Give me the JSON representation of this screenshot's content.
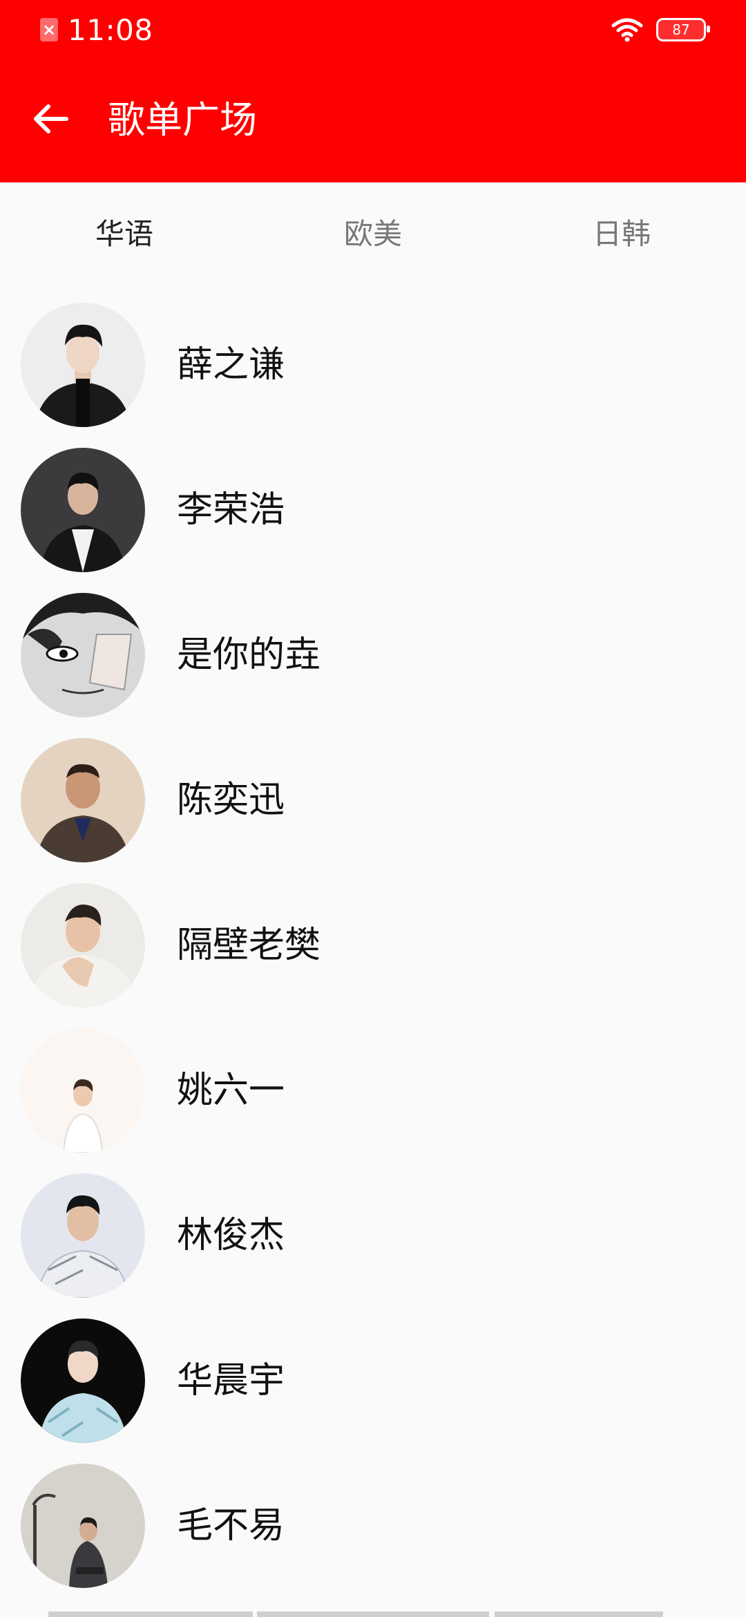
{
  "status_bar": {
    "time": "11:08",
    "battery_level": "87"
  },
  "toolbar": {
    "title": "歌单广场"
  },
  "tabs": [
    {
      "label": "华语",
      "active": true
    },
    {
      "label": "欧美",
      "active": false
    },
    {
      "label": "日韩",
      "active": false
    }
  ],
  "artists": [
    {
      "name": "薛之谦"
    },
    {
      "name": "李荣浩"
    },
    {
      "name": "是你的垚"
    },
    {
      "name": "陈奕迅"
    },
    {
      "name": "隔壁老樊"
    },
    {
      "name": "姚六一"
    },
    {
      "name": "林俊杰"
    },
    {
      "name": "华晨宇"
    },
    {
      "name": "毛不易"
    }
  ],
  "colors": {
    "header": "#ff0000",
    "background": "#fafafa",
    "text_primary": "#111111",
    "tab_inactive": "#777777"
  },
  "icons": {
    "back": "arrow-left",
    "wifi": "wifi",
    "battery": "battery",
    "sim": "sim-card-error"
  }
}
